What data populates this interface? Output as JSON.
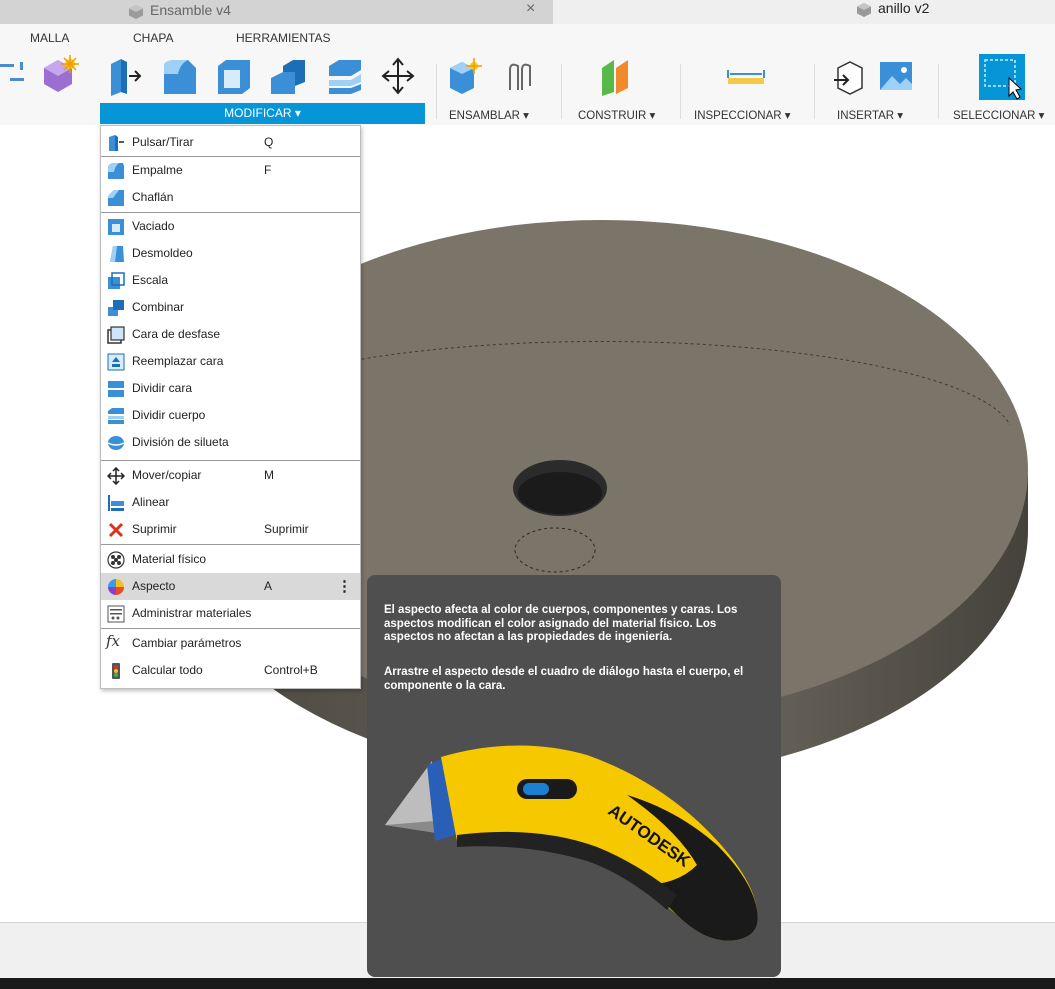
{
  "tabs": {
    "active_doc": "Ensamble v4",
    "close_glyph": "×",
    "other_doc": "anillo v2"
  },
  "toolbar": {
    "categories": [
      "MALLA",
      "CHAPA",
      "HERRAMIENTAS"
    ],
    "groups": {
      "modificar": "MODIFICAR ▾",
      "ensamblar": "ENSAMBLAR ▾",
      "construir": "CONSTRUIR ▾",
      "inspeccionar": "INSPECCIONAR ▾",
      "insertar": "INSERTAR ▾",
      "seleccionar": "SELECCIONAR ▾"
    }
  },
  "menu": {
    "items": [
      {
        "label": "Pulsar/Tirar",
        "shortcut": "Q",
        "icon": "press-pull-icon"
      },
      {
        "label": "Empalme",
        "shortcut": "F",
        "icon": "fillet-icon"
      },
      {
        "label": "Chaflán",
        "shortcut": "",
        "icon": "chamfer-icon"
      },
      {
        "label": "Vaciado",
        "shortcut": "",
        "icon": "shell-icon"
      },
      {
        "label": "Desmoldeo",
        "shortcut": "",
        "icon": "draft-icon"
      },
      {
        "label": "Escala",
        "shortcut": "",
        "icon": "scale-icon"
      },
      {
        "label": "Combinar",
        "shortcut": "",
        "icon": "combine-icon"
      },
      {
        "label": "Cara de desfase",
        "shortcut": "",
        "icon": "offset-face-icon"
      },
      {
        "label": "Reemplazar cara",
        "shortcut": "",
        "icon": "replace-face-icon"
      },
      {
        "label": "Dividir cara",
        "shortcut": "",
        "icon": "split-face-icon"
      },
      {
        "label": "Dividir cuerpo",
        "shortcut": "",
        "icon": "split-body-icon"
      },
      {
        "label": "División de silueta",
        "shortcut": "",
        "icon": "silhouette-split-icon"
      },
      {
        "label": "Mover/copiar",
        "shortcut": "M",
        "icon": "move-copy-icon"
      },
      {
        "label": "Alinear",
        "shortcut": "",
        "icon": "align-icon"
      },
      {
        "label": "Suprimir",
        "shortcut": "Suprimir",
        "icon": "delete-icon"
      },
      {
        "label": "Material físico",
        "shortcut": "",
        "icon": "physical-material-icon"
      },
      {
        "label": "Aspecto",
        "shortcut": "A",
        "icon": "appearance-icon"
      },
      {
        "label": "Administrar materiales",
        "shortcut": "",
        "icon": "manage-materials-icon"
      },
      {
        "label": "Cambiar parámetros",
        "shortcut": "",
        "icon": "fx-parameters-icon"
      },
      {
        "label": "Calcular todo",
        "shortcut": "Control+B",
        "icon": "compute-all-icon"
      }
    ],
    "more_glyph": "⋮"
  },
  "tooltip": {
    "para1": "El aspecto afecta al color de cuerpos, componentes y caras. Los aspectos modifican el color asignado del material físico. Los aspectos no afectan a las propiedades de ingeniería.",
    "para2": "Arrastre el aspecto desde el cuadro de diálogo hasta el cuerpo, el componente o la cara.",
    "brand": "AUTODESK"
  },
  "colors": {
    "accent": "#0696d7",
    "tooltip_bg": "#4f4f4f",
    "model_face": "#7a7568"
  }
}
